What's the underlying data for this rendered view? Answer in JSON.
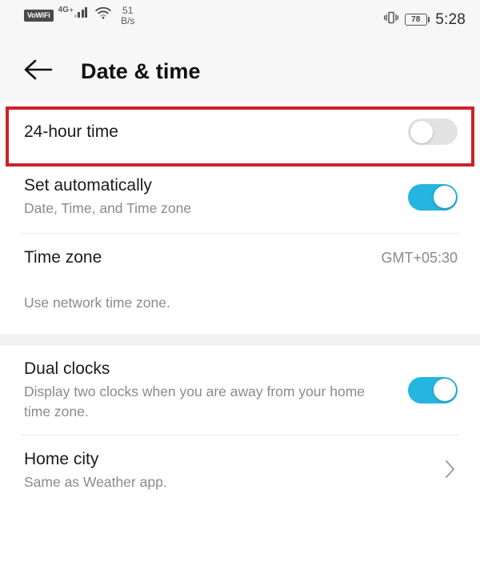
{
  "status_bar": {
    "vowifi_label": "VoWiFi",
    "network_type": "4G",
    "network_plus": "+",
    "data_rate_value": "51",
    "data_rate_unit": "B/s",
    "battery_level": "78",
    "clock": "5:28",
    "icons": {
      "signal": "signal-bars-icon",
      "wifi": "wifi-icon",
      "vibrate": "vibrate-icon",
      "battery": "battery-icon"
    }
  },
  "app_bar": {
    "back_icon": "back-arrow-icon",
    "title": "Date & time"
  },
  "settings": {
    "rows": [
      {
        "title": "24-hour time",
        "subtitle": "",
        "value": "",
        "toggle": "off",
        "highlighted": true
      },
      {
        "title": "Set automatically",
        "subtitle": "Date, Time, and Time zone",
        "value": "",
        "toggle": "on",
        "highlighted": false
      },
      {
        "title": "Time zone",
        "subtitle": "",
        "value": "GMT+05:30",
        "toggle": "none",
        "highlighted": false
      },
      {
        "title": "",
        "subtitle": "Use network time zone.",
        "value": "",
        "toggle": "none",
        "highlighted": false
      },
      {
        "title": "Dual clocks",
        "subtitle": "Display two clocks when you are away from your home time zone.",
        "value": "",
        "toggle": "on",
        "highlighted": false
      },
      {
        "title": "Home city",
        "subtitle": "Same as Weather app.",
        "value": "",
        "toggle": "none",
        "chevron": "chevron-right-icon",
        "highlighted": false
      }
    ]
  },
  "colors": {
    "accent_toggle_on": "#24b5e0",
    "toggle_off_track": "#e2e2e2",
    "highlight_border": "#cc2229",
    "header_background": "#f7f7f7",
    "primary_text": "#1b1b1b",
    "secondary_text": "#8a8a8a"
  }
}
